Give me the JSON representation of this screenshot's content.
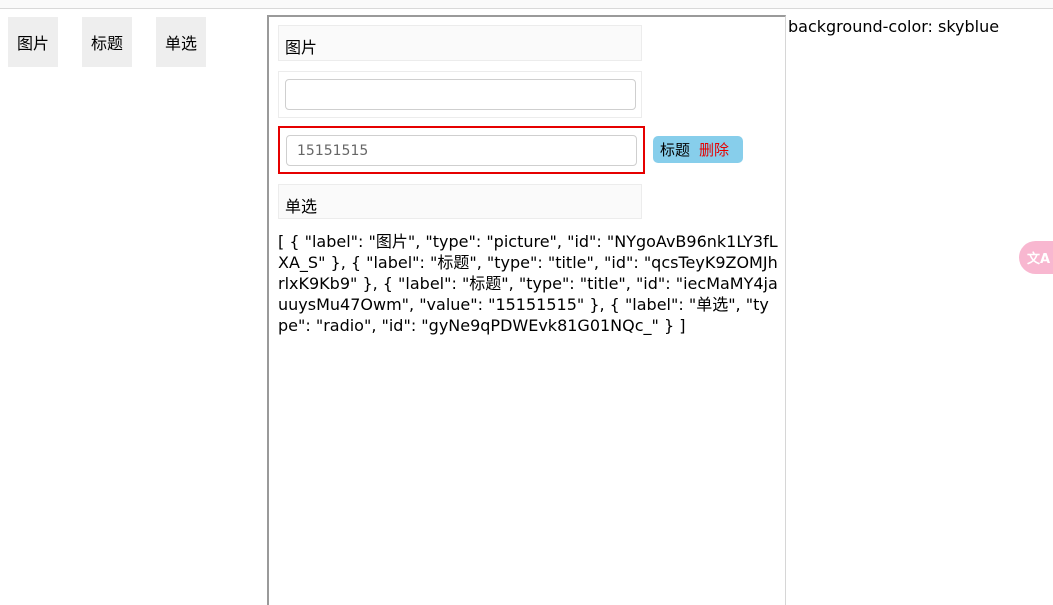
{
  "palette": {
    "picture_label": "图片",
    "title_label": "标题",
    "radio_label": "单选"
  },
  "canvas": {
    "picture_field_label": "图片",
    "empty_input_value": "",
    "selected_input_value": "15151515",
    "selected_actions": {
      "title": "标题",
      "delete": "删除"
    },
    "radio_field_label": "单选",
    "json_output": "[ { \"label\": \"图片\", \"type\": \"picture\", \"id\": \"NYgoAvB96nk1LY3fLXA_S\" }, { \"label\": \"标题\", \"type\": \"title\", \"id\": \"qcsTeyK9ZOMJhrlxK9Kb9\" }, { \"label\": \"标题\", \"type\": \"title\", \"id\": \"iecMaMY4jauuysMu47Owm\", \"value\": \"15151515\" }, { \"label\": \"单选\", \"type\": \"radio\", \"id\": \"gyNe9qPDWEvk81G01NQc_\" } ]"
  },
  "side_note": "background-color: skyblue",
  "floating_widget": {
    "icon": "translate-icon",
    "glyph": "文A"
  },
  "colors": {
    "selected_border": "#e60000",
    "badge_bg": "#87ceeb",
    "delete_text": "#e60000",
    "palette_bg": "#eeeeee",
    "floater_bg": "#f8b7d0"
  }
}
